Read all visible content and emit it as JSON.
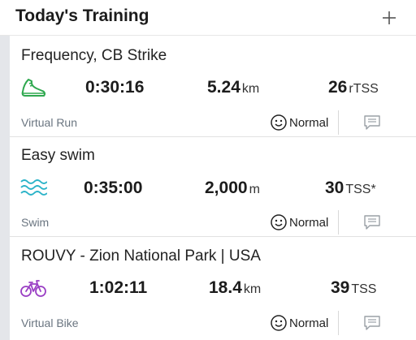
{
  "header": {
    "title": "Today's Training"
  },
  "workouts": [
    {
      "title": "Frequency, CB Strike",
      "duration": "0:30:16",
      "distance_value": "5.24",
      "distance_unit": "km",
      "tss_value": "26",
      "tss_unit": "rTSS",
      "sport_label": "Virtual Run",
      "feel": "Normal",
      "icon": "running-shoe-icon",
      "icon_color": "#2fa84f"
    },
    {
      "title": "Easy swim",
      "duration": "0:35:00",
      "distance_value": "2,000",
      "distance_unit": "m",
      "tss_value": "30",
      "tss_unit": "TSS*",
      "sport_label": "Swim",
      "feel": "Normal",
      "icon": "swim-waves-icon",
      "icon_color": "#2bb3c8"
    },
    {
      "title": "ROUVY - Zion National Park | USA",
      "duration": "1:02:11",
      "distance_value": "18.4",
      "distance_unit": "km",
      "tss_value": "39",
      "tss_unit": "TSS",
      "sport_label": "Virtual Bike",
      "feel": "Normal",
      "icon": "bicycle-icon",
      "icon_color": "#9a3fc4"
    }
  ]
}
